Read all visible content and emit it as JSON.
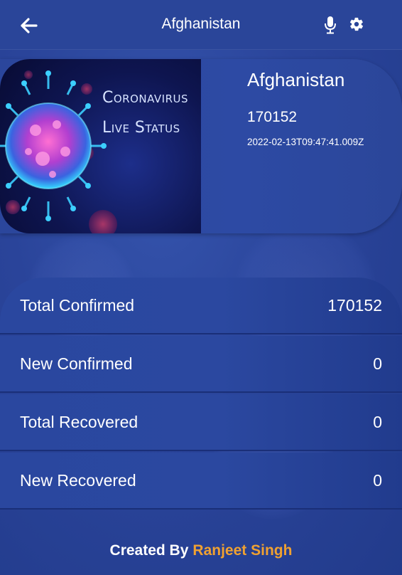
{
  "app_bar": {
    "title": "Afghanistan",
    "back_icon": "arrow-left-icon",
    "mic_icon": "microphone-icon",
    "settings_icon": "gear-icon"
  },
  "country_card": {
    "banner_line1": "Coronavirus",
    "banner_line2": "Live Status",
    "country": "Afghanistan",
    "total": "170152",
    "updated": "2022-02-13T09:47:41.009Z"
  },
  "stats": [
    {
      "label": "Total Confirmed",
      "value": "170152"
    },
    {
      "label": "New Confirmed",
      "value": "0"
    },
    {
      "label": "Total Recovered",
      "value": "0"
    },
    {
      "label": "New Recovered",
      "value": "0"
    }
  ],
  "footer": {
    "prefix": "Created By",
    "author": "Ranjeet Singh"
  },
  "colors": {
    "background": "#2a449a",
    "accent": "#f0a131",
    "text": "#ffffff"
  }
}
